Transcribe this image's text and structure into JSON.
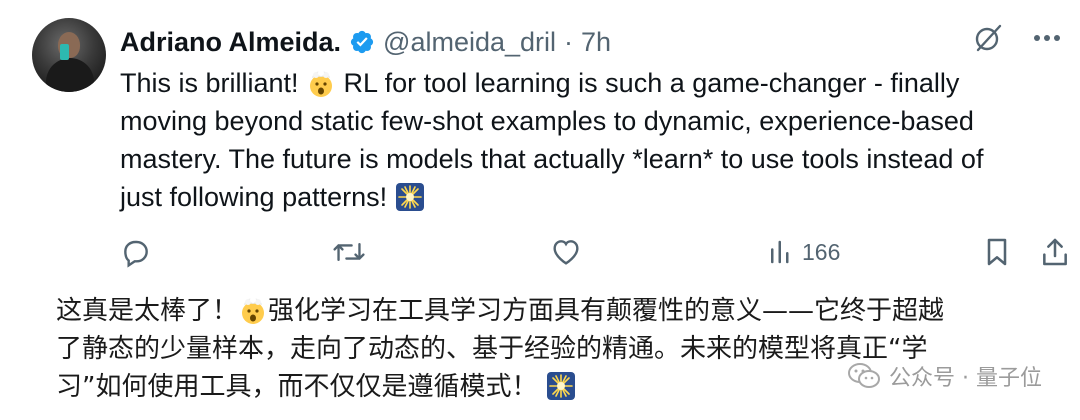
{
  "tweet": {
    "author_name": "Adriano Almeida.",
    "handle": "@almeida_dril",
    "separator": "·",
    "time": "7h",
    "text_lines": [
      "This is brilliant! ",
      " RL for tool learning is such a game-changer - finally",
      "moving beyond static few-shot examples to dynamic, experience-based",
      "mastery. The future is models that actually *learn* to use tools instead of",
      "just following patterns! "
    ],
    "views_count": "166",
    "icons": {
      "verified": "verified-badge-icon",
      "grok": "grok-icon",
      "more": "more-icon",
      "reply": "reply-icon",
      "retweet": "retweet-icon",
      "like": "like-icon",
      "views": "views-icon",
      "bookmark": "bookmark-icon",
      "share": "share-icon",
      "emoji_1": "exploding-head-emoji",
      "emoji_2": "sparkle-emoji"
    },
    "colors": {
      "verified": "#1d9bf0",
      "secondary_text": "#536471"
    }
  },
  "translation": {
    "line1_a": "这真是太棒了！",
    "line1_b": "强化学习在工具学习方面具有颠覆性的意义——它终于超越",
    "line2": "了静态的少量样本，走向了动态的、基于经验的精通。未来的模型将真正“学",
    "line3": "习”如何使用工具，而不仅仅是遵循模式！"
  },
  "watermark": {
    "text": "公众号 · 量子位",
    "icon": "wechat-icon"
  }
}
